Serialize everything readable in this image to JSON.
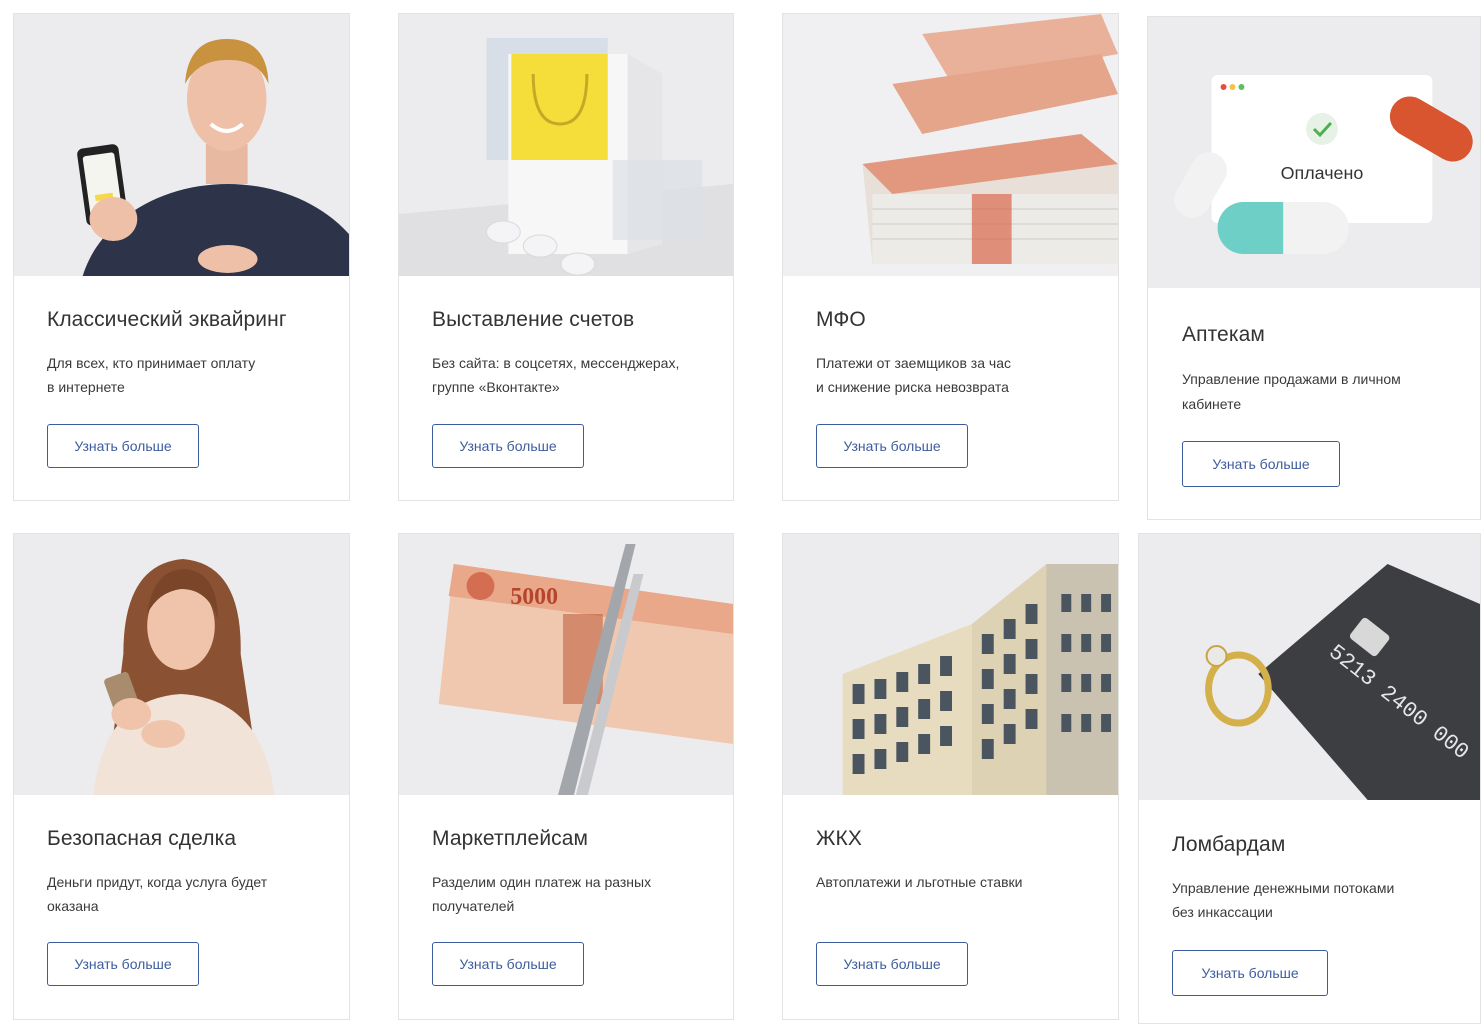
{
  "button_label": "Узнать больше",
  "accent_color": "#3d5c9e",
  "cards": [
    {
      "title": "Классический эквайринг",
      "desc_line1": "Для всех, кто принимает оплату",
      "desc_line2": "в интернете",
      "image": "man-with-phone-photo"
    },
    {
      "title": "Выставление счетов",
      "desc_line1": "Без сайта: в соцсетях, мессенджерах,",
      "desc_line2": "группе «Вконтакте»",
      "image": "shopping-bag-photo"
    },
    {
      "title": "МФО",
      "desc_line1": "Платежи от заемщиков за час",
      "desc_line2": "и снижение риска невозврата",
      "image": "banknote-stacks-photo"
    },
    {
      "title": "Аптекам",
      "desc_line1": "Управление продажами в личном",
      "desc_line2": "кабинете",
      "image": "pills-window-photo",
      "image_text": "Оплачено"
    },
    {
      "title": "Безопасная сделка",
      "desc_line1": "Деньги придут, когда услуга будет",
      "desc_line2": "оказана",
      "image": "woman-with-phone-photo"
    },
    {
      "title": "Маркетплейсам",
      "desc_line1": "Разделим один платеж на разных",
      "desc_line2": "получателей",
      "image": "banknote-scissors-photo",
      "image_text": "5000"
    },
    {
      "title": "ЖКХ",
      "desc_line1": "Автоплатежи и льготные ставки",
      "desc_line2": "",
      "image": "apartment-building-photo"
    },
    {
      "title": "Ломбардам",
      "desc_line1": "Управление денежными потоками",
      "desc_line2": "без инкассации",
      "image": "card-and-ring-photo",
      "image_text": "5213 2400 000"
    }
  ]
}
